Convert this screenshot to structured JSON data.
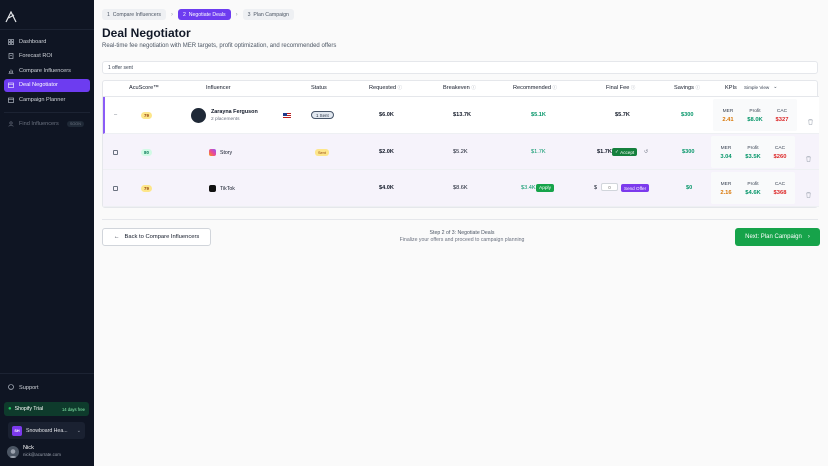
{
  "sidebar": {
    "items": [
      {
        "label": "Dashboard",
        "icon": "dashboard-icon"
      },
      {
        "label": "Forecast ROI",
        "icon": "document-icon"
      },
      {
        "label": "Compare Influencers",
        "icon": "chart-icon"
      },
      {
        "label": "Deal Negotiator",
        "icon": "calendar-icon",
        "active": true
      },
      {
        "label": "Campaign Planner",
        "icon": "calendar-icon"
      }
    ],
    "find": {
      "label": "Find Influencers",
      "badge": "SOON"
    },
    "support": "Support",
    "trial": {
      "label": "Shopify Trial",
      "days": "14 days free"
    },
    "store": {
      "initials": "SH",
      "name": "Snowboard Hea..."
    },
    "user": {
      "name": "Nick",
      "email": "nick@acurrate.com"
    }
  },
  "breadcrumb": [
    {
      "num": "1",
      "label": "Compare Influencers"
    },
    {
      "num": "2",
      "label": "Negotiate Deals"
    },
    {
      "num": "3",
      "label": "Plan Campaign"
    }
  ],
  "page": {
    "title": "Deal Negotiator",
    "subtitle": "Real-time fee negotiation with MER targets, profit optimization, and recommended offers",
    "offers_sent": "1 offer sent"
  },
  "table": {
    "headers": {
      "score": "AcuScore™",
      "influencer": "Influencer",
      "status": "Status",
      "requested": "Requested",
      "breakeven": "Breakeven",
      "recommended": "Recommended",
      "final_fee": "Final Fee",
      "savings": "Savings",
      "kpis": "KPIs",
      "view": "Simple View"
    },
    "kpi_labels": {
      "mer": "MER",
      "profit": "Profit",
      "cac": "CAC"
    },
    "rows": [
      {
        "score": "79",
        "name": "Zarayna Ferguson",
        "placements": "2 placements",
        "status": "1 Sent",
        "requested": "$6.0K",
        "breakeven": "$13.7K",
        "recommended": "$5.1K",
        "final_fee": "$5.7K",
        "savings": "$300",
        "mer": "2.41",
        "profit": "$8.0K",
        "cac": "$327"
      },
      {
        "score": "80",
        "platform": "Story",
        "status": "Sent",
        "requested": "$2.0K",
        "breakeven": "$5.2K",
        "recommended": "$1.7K",
        "final_fee": "$1.7K",
        "accept": "Accept",
        "savings": "$300",
        "mer": "3.04",
        "profit": "$3.5K",
        "cac": "$260"
      },
      {
        "score": "79",
        "platform": "TikTok",
        "requested": "$4.0K",
        "breakeven": "$8.6K",
        "recommended": "$3.4K",
        "apply": "Apply",
        "currency": "$",
        "fee_placeholder": "0",
        "send": "Send Offer",
        "savings": "$0",
        "mer": "2.16",
        "profit": "$4.6K",
        "cac": "$368"
      }
    ]
  },
  "footer": {
    "back": "Back to Compare Influencers",
    "step_title": "Step 2 of 3: Negotiate Deals",
    "step_desc": "Finalize your offers and proceed to campaign planning",
    "next": "Next: Plan Campaign"
  }
}
